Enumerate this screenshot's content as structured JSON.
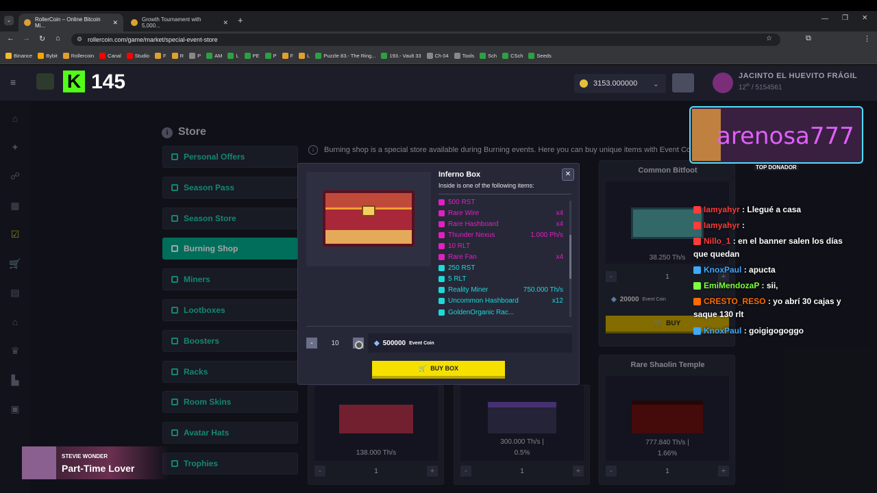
{
  "browser": {
    "tabs": [
      {
        "title": "RollerCoin – Online Bitcoin Mi...",
        "active": true
      },
      {
        "title": "Growth Tournament with 5,000...",
        "active": false
      }
    ],
    "url": "rollercoin.com/game/market/special-event-store",
    "bookmarks": [
      "Binance",
      "Bybit",
      "Rollercoin",
      "Canal",
      "Studio",
      "F",
      "R",
      "P",
      "AM",
      "L",
      "PE",
      "P",
      "F",
      "L",
      "Puzzle 83.- The Ring...",
      "193.- Vault 33",
      "Ch 04",
      "Tools",
      "Sch",
      "CSch",
      "Seeds"
    ]
  },
  "header": {
    "logo_letter": "K",
    "logo_number": "145",
    "balance": "3153.000000",
    "username": "JACINTO EL HUEVITO FRÁGIL",
    "rank": "12",
    "rank_sup": "th",
    "rank_total": "/ 5154561"
  },
  "store": {
    "title": "Store",
    "info": "Burning shop is a special store available during Burning events. Here you can buy unique items with Event Coins.",
    "menu": [
      {
        "label": "Personal Offers",
        "active": false
      },
      {
        "label": "Season Pass",
        "active": false
      },
      {
        "label": "Season Store",
        "active": false
      },
      {
        "label": "Burning Shop",
        "active": true
      },
      {
        "label": "Miners",
        "active": false
      },
      {
        "label": "Lootboxes",
        "active": false
      },
      {
        "label": "Boosters",
        "active": false
      },
      {
        "label": "Racks",
        "active": false
      },
      {
        "label": "Room Skins",
        "active": false
      },
      {
        "label": "Avatar Hats",
        "active": false
      },
      {
        "label": "Trophies",
        "active": false
      }
    ],
    "cards": {
      "common_bitfoot": {
        "title": "Common Bitfoot",
        "power": "38.250 Th/s",
        "qty": "1",
        "price": "20000",
        "currency": "Event Coin",
        "buy": "BUY"
      },
      "rare_shaolin": {
        "title": "Rare Shaolin Temple",
        "power": "777.840 Th/s |",
        "bonus": "1.66%",
        "qty": "1"
      },
      "bottom_left": {
        "power": "138.000 Th/s",
        "qty": "1"
      },
      "bottom_mid": {
        "power": "300.000 Th/s |",
        "bonus": "0.5%",
        "qty": "1"
      }
    }
  },
  "modal": {
    "title": "Inferno Box",
    "subtitle": "Inside is one of the following items:",
    "items": [
      {
        "name": "500 RST",
        "extra": "",
        "color": "#e020c0"
      },
      {
        "name": "Rare Wire",
        "extra": "x4",
        "color": "#e020c0"
      },
      {
        "name": "Rare Hashboard",
        "extra": "x4",
        "color": "#e020c0"
      },
      {
        "name": "Thunder Nexus",
        "extra": "1.000 Ph/s",
        "color": "#e020c0"
      },
      {
        "name": "10 RLT",
        "extra": "",
        "color": "#e020c0"
      },
      {
        "name": "Rare Fan",
        "extra": "x4",
        "color": "#e020c0"
      },
      {
        "name": "250 RST",
        "extra": "",
        "color": "#20d8d8"
      },
      {
        "name": "5 RLT",
        "extra": "",
        "color": "#20d8d8"
      },
      {
        "name": "Reality Miner",
        "extra": "750.000 Th/s",
        "color": "#20d8d8"
      },
      {
        "name": "Uncommon Hashboard",
        "extra": "x12",
        "color": "#20d8d8"
      },
      {
        "name": "GoldenOrganic Rac...",
        "extra": "",
        "color": "#20d8d8"
      }
    ],
    "qty": "10",
    "price": "500000",
    "currency": "Event Coin",
    "buy": "BUY BOX"
  },
  "overlay": {
    "streamer": "arenosa777",
    "donor_label": "TOP DONADOR",
    "chat": [
      {
        "user": "Iamyahyr",
        "msg": ": Llegué a casa",
        "color": "#ff3b3b"
      },
      {
        "user": "Iamyahyr",
        "msg": ":",
        "color": "#ff3b3b"
      },
      {
        "user": "Nillo_1",
        "msg": ": en el banner salen los días que quedan",
        "color": "#ff3b3b"
      },
      {
        "user": "KnoxPaul",
        "msg": ": apucta",
        "color": "#3fa9ff"
      },
      {
        "user": "EmiMendozaP",
        "msg": ": sii,",
        "color": "#7fff3f"
      },
      {
        "user": "CRESTO_RESO",
        "msg": ": yo abrí 30 cajas y saque 130 rlt",
        "color": "#ff6a00"
      },
      {
        "user": "KnoxPaul",
        "msg": ": goigigogoggo",
        "color": "#3fa9ff"
      }
    ],
    "music_artist": "STEVIE WONDER",
    "music_title": "Part-Time Lover"
  }
}
